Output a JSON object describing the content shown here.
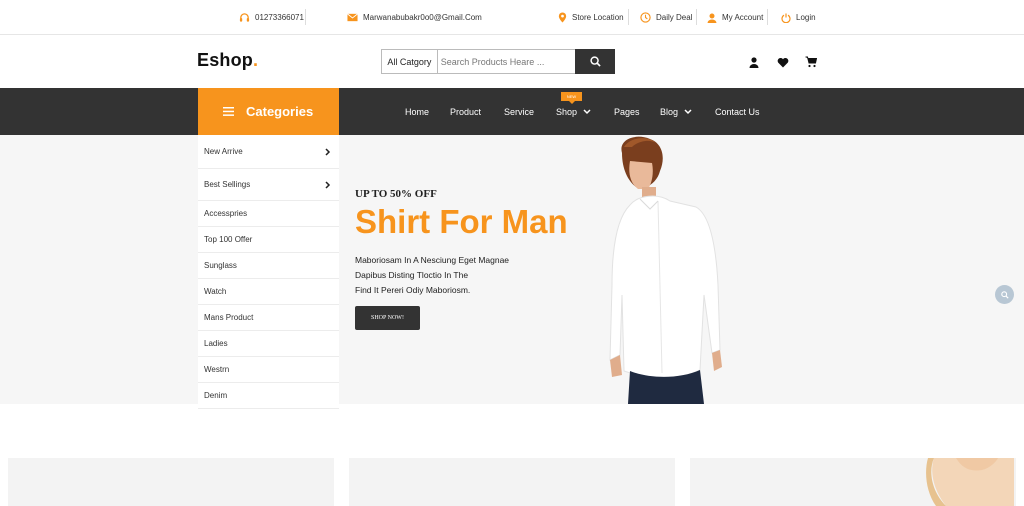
{
  "topbar": {
    "phone": "01273366071",
    "email": "Marwanabubakr0o0@Gmail.Com",
    "store_location": "Store Location",
    "daily_deal": "Daily Deal",
    "my_account": "My Account",
    "login": "Login"
  },
  "header": {
    "logo": "Eshop",
    "logo_dot": ".",
    "search_category": "All Catgory",
    "search_placeholder": "Search Products Heare ..."
  },
  "nav": {
    "categories_label": "Categories",
    "items": [
      "Home",
      "Product",
      "Service",
      "Shop",
      "Pages",
      "Blog",
      "Contact Us"
    ],
    "new_badge": "NEW"
  },
  "sidebar": {
    "items": [
      "New Arrive",
      "Best Sellings",
      "Accesspries",
      "Top 100 Offer",
      "Sunglass",
      "Watch",
      "Mans Product",
      "Ladies",
      "Westrn",
      "Denim"
    ]
  },
  "hero": {
    "kicker": "UP TO 50% OFF",
    "title": "Shirt For Man",
    "description_lines": [
      "Maboriosam In A Nesciung Eget Magnae",
      "Dapibus Disting Tloctio In The",
      "Find It Pereri Odiy Maboriosm."
    ],
    "cta": "SHOP NOW!"
  },
  "colors": {
    "accent": "#f7941d",
    "dark": "#333333",
    "hero_bg": "#f6f6f6"
  }
}
